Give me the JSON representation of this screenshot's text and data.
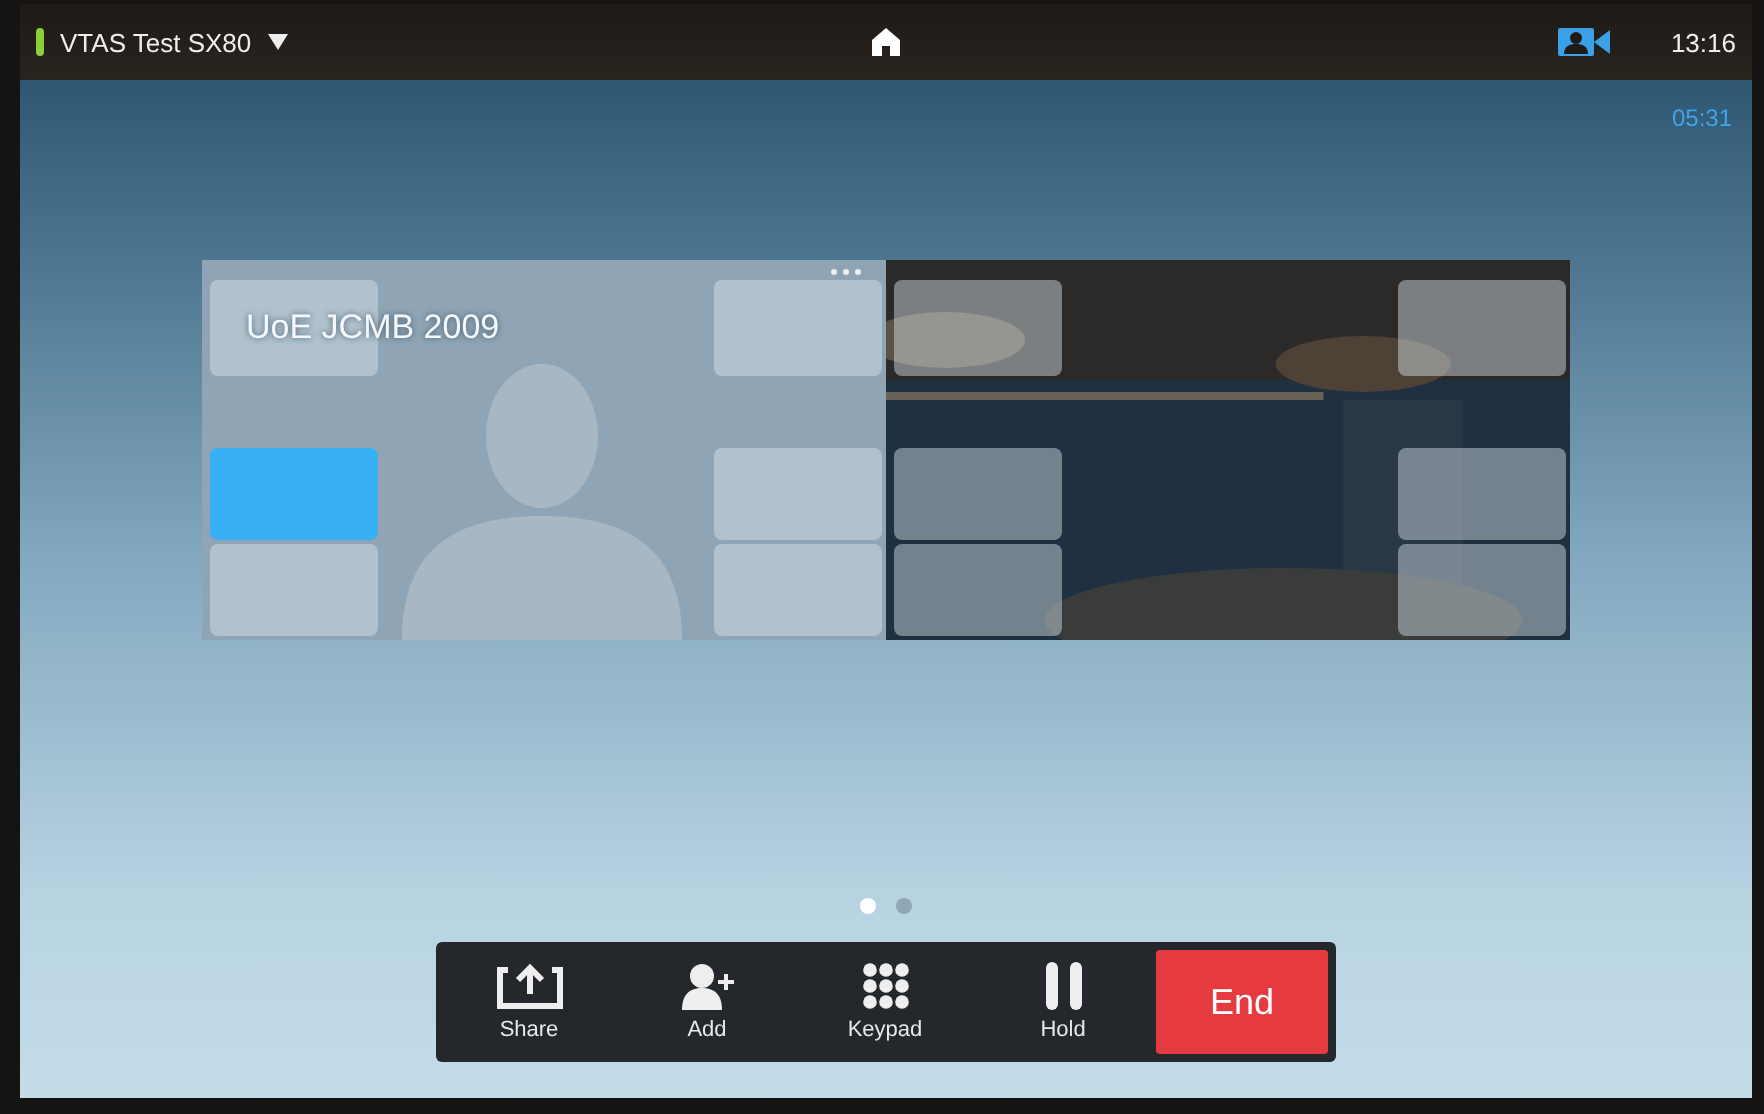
{
  "header": {
    "device_name": "VTAS Test SX80",
    "time": "13:16"
  },
  "call_timer": "05:31",
  "self_view": {
    "title": "UoE JCMB 2009",
    "tiles": [
      {
        "selected": false
      },
      {
        "selected": true
      },
      {
        "selected": false
      },
      {
        "selected": false
      },
      {
        "selected": false
      },
      {
        "selected": false
      }
    ]
  },
  "remote_view": {
    "tiles": [
      {
        "selected": false
      },
      {
        "selected": false
      },
      {
        "selected": false
      },
      {
        "selected": false
      },
      {
        "selected": false
      },
      {
        "selected": false
      }
    ]
  },
  "pages": [
    {
      "selected": true
    },
    {
      "selected": false
    }
  ],
  "toolbar": [
    {
      "kind": "share",
      "label": "Share"
    },
    {
      "kind": "add",
      "label": "Add"
    },
    {
      "kind": "keypad",
      "label": "Keypad"
    },
    {
      "kind": "hold",
      "label": "Hold"
    },
    {
      "kind": "end",
      "label": "End"
    }
  ]
}
